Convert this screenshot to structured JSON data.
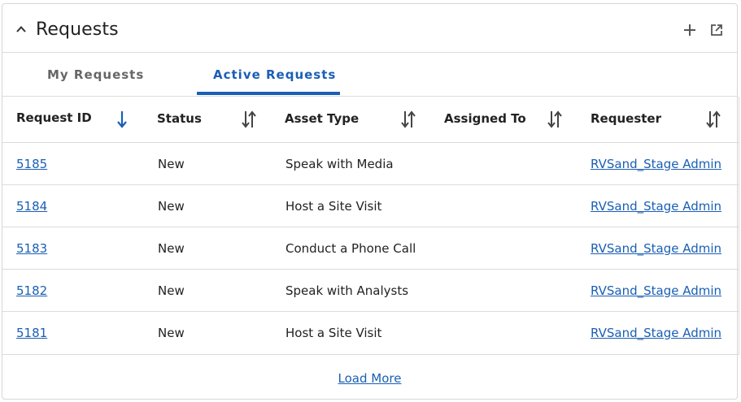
{
  "widget": {
    "title": "Requests"
  },
  "tabs": [
    {
      "label": "My Requests",
      "active": false
    },
    {
      "label": "Active Requests",
      "active": true
    }
  ],
  "table": {
    "columns": [
      "Request ID",
      "Status",
      "Asset Type",
      "Assigned To",
      "Requester"
    ],
    "rows": [
      {
        "id": "5185",
        "status": "New",
        "asset_type": "Speak with Media",
        "assigned_to": "",
        "requester": "RVSand_Stage Admin"
      },
      {
        "id": "5184",
        "status": "New",
        "asset_type": "Host a Site Visit",
        "assigned_to": "",
        "requester": "RVSand_Stage Admin"
      },
      {
        "id": "5183",
        "status": "New",
        "asset_type": "Conduct a Phone Call",
        "assigned_to": "",
        "requester": "RVSand_Stage Admin"
      },
      {
        "id": "5182",
        "status": "New",
        "asset_type": "Speak with Analysts",
        "assigned_to": "",
        "requester": "RVSand_Stage Admin"
      },
      {
        "id": "5181",
        "status": "New",
        "asset_type": "Host a Site Visit",
        "assigned_to": "",
        "requester": "RVSand_Stage Admin"
      }
    ]
  },
  "footer": {
    "load_more": "Load More"
  },
  "colors": {
    "accent": "#1a5fb4",
    "border": "#dcdcdc",
    "text": "#222222"
  }
}
